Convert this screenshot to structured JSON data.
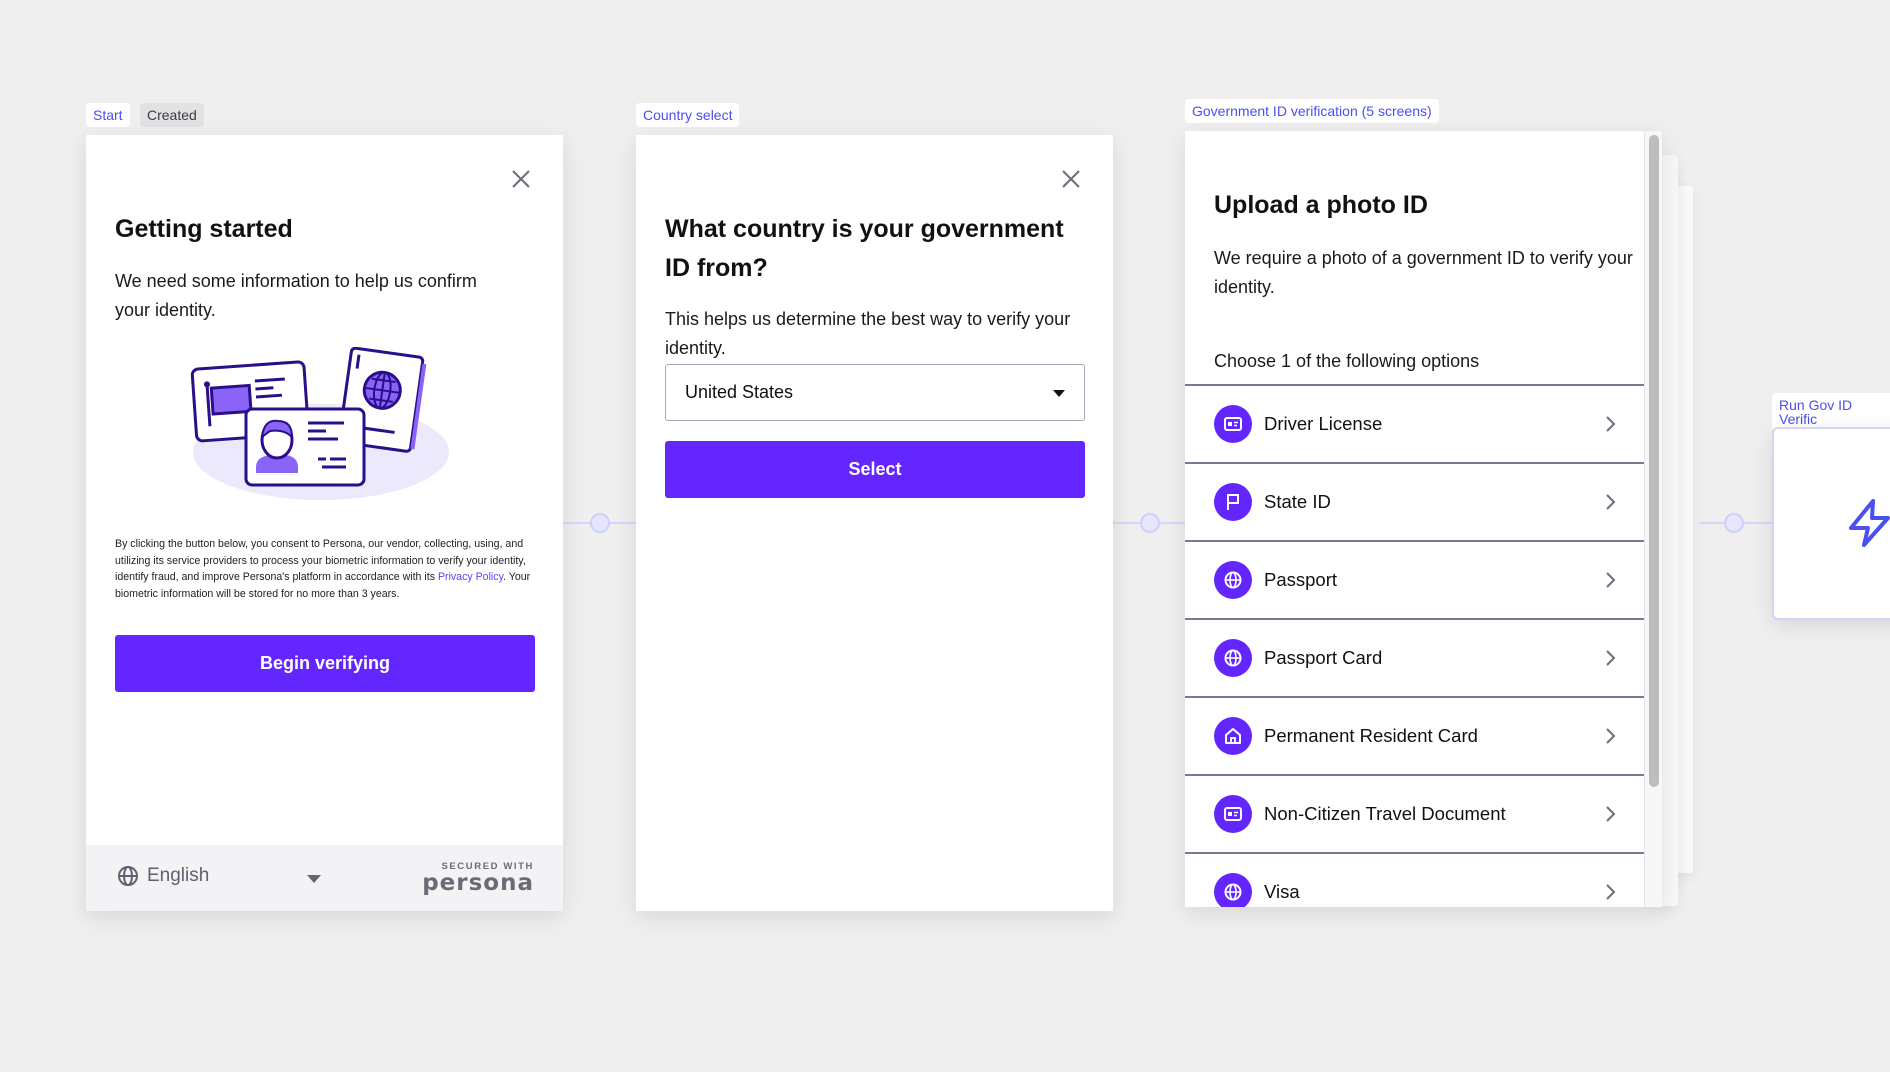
{
  "colors": {
    "brand": "#6326ff",
    "tag_text": "#4a4ff0",
    "connector": "#d4d6fb",
    "background": "#efeff0"
  },
  "nodes": [
    {
      "tag": "Start",
      "status_badge": "Created",
      "screen": {
        "title": "Getting started",
        "body": "We need some information to help us confirm your identity.",
        "illustration": "id-cards-illustration",
        "consent_text_before": "By clicking the button below, you consent to Persona, our vendor, collecting, using, and utilizing its service providers to process your biometric information to verify your identity, identify fraud, and improve Persona's platform in accordance with its ",
        "consent_link": "Privacy Policy",
        "consent_text_after": ". Your biometric information will be stored for no more than 3 years.",
        "primary_button": "Begin verifying",
        "footer": {
          "language": "English",
          "secured_with": "SECURED WITH",
          "brand_name": "persona"
        }
      }
    },
    {
      "tag": "Country select",
      "screen": {
        "title": "What country is your government ID from?",
        "body": "This helps us determine the best way to verify your identity.",
        "country_select_value": "United States",
        "primary_button": "Select"
      }
    },
    {
      "tag": "Government ID verification",
      "tag_count": "(5 screens)",
      "screen": {
        "title": "Upload a photo ID",
        "body": "We require a photo of a government ID to verify your identity.",
        "options_heading": "Choose 1 of the following options",
        "options": [
          {
            "label": "Driver License",
            "icon": "id-card-icon"
          },
          {
            "label": "State ID",
            "icon": "flag-icon"
          },
          {
            "label": "Passport",
            "icon": "globe-icon"
          },
          {
            "label": "Passport Card",
            "icon": "globe-icon"
          },
          {
            "label": "Permanent Resident Card",
            "icon": "home-icon"
          },
          {
            "label": "Non-Citizen Travel Document",
            "icon": "id-card-icon"
          },
          {
            "label": "Visa",
            "icon": "globe-icon"
          }
        ]
      }
    },
    {
      "tag": "Run Gov ID Verific",
      "icon": "lightning-icon"
    }
  ]
}
